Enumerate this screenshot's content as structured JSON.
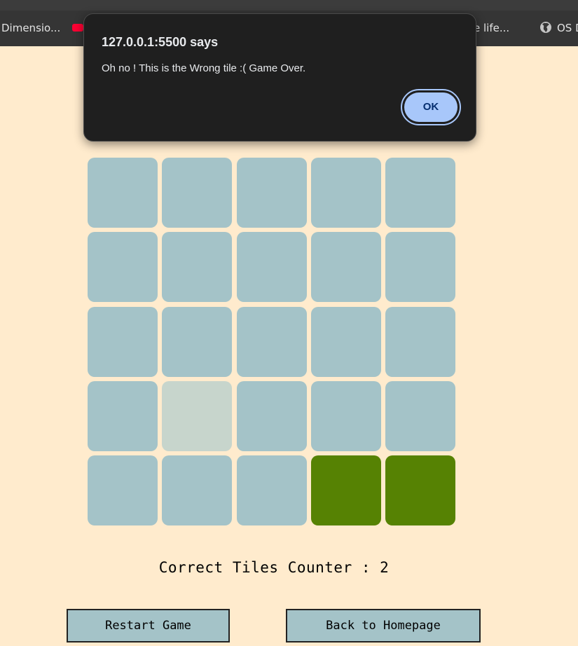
{
  "browser": {
    "bookmarks": [
      {
        "label": "Dimensio..."
      },
      {
        "label": "e life..."
      },
      {
        "label": "OS D"
      }
    ],
    "bookmark_icons": [
      "youtube-icon",
      "globe-icon"
    ]
  },
  "alert": {
    "origin": "127.0.0.1:5500 says",
    "message": "Oh no ! This is the Wrong tile :( Game Over.",
    "ok_label": "OK",
    "accent_color": "#a8c7fa"
  },
  "game": {
    "rows": 5,
    "cols": 5,
    "colors": {
      "default": "#a4c3c8",
      "correct": "#568203",
      "wrong": "#c7d5cc"
    },
    "tiles": [
      [
        "default",
        "default",
        "default",
        "default",
        "default"
      ],
      [
        "default",
        "default",
        "default",
        "default",
        "default"
      ],
      [
        "default",
        "default",
        "default",
        "default",
        "default"
      ],
      [
        "default",
        "wrong",
        "default",
        "default",
        "default"
      ],
      [
        "default",
        "default",
        "default",
        "correct",
        "correct"
      ]
    ],
    "counter_label": "Correct Tiles Counter : ",
    "counter_value": "2",
    "restart_label": "Restart Game",
    "home_label": "Back to Homepage"
  }
}
